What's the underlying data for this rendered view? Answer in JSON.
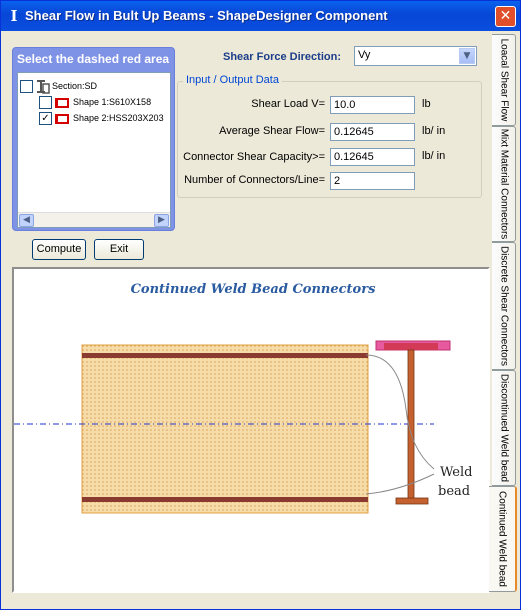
{
  "window": {
    "title": "Shear Flow in Bult Up Beams - ShapeDesigner Component",
    "close_glyph": "✕"
  },
  "selection_panel": {
    "title": "Select the dashed red area",
    "tree": [
      {
        "label": "Section:SD",
        "checked": false
      },
      {
        "label": "Shape 1:S610X158",
        "checked": false
      },
      {
        "label": "Shape 2:HSS203X203",
        "checked": true
      }
    ]
  },
  "buttons": {
    "compute": "Compute",
    "exit": "Exit"
  },
  "shear_direction": {
    "label": "Shear Force Direction:",
    "value": "Vy"
  },
  "io": {
    "legend": "Input / Output Data",
    "fields": [
      {
        "label": "Shear Load V=",
        "value": "10.0",
        "unit": "lb"
      },
      {
        "label": "Average Shear Flow=",
        "value": "0.12645",
        "unit": "lb/ in"
      },
      {
        "label": "Connector Shear Capacity>=",
        "value": "0.12645",
        "unit": "lb/ in"
      },
      {
        "label": "Number of Connectors/Line=",
        "value": "2",
        "unit": ""
      }
    ]
  },
  "display": {
    "title": "Continued Weld Bead Connectors",
    "annotation_line1": "Weld",
    "annotation_line2": "bead",
    "colors": {
      "plate_fill": "#f3d79f",
      "plate_border": "#e0a040",
      "weld_bar": "#8b3a2f",
      "ibeam": "#c4612e",
      "flange_highlight": "#e85aa0",
      "axis": "#2233cc"
    }
  },
  "tabs": [
    {
      "label": "Loacal Shear Flow",
      "selected": false
    },
    {
      "label": "Mixt Material Connectors",
      "selected": false
    },
    {
      "label": "Discrete Shear Connectors",
      "selected": false
    },
    {
      "label": "Discontinued Weld bead",
      "selected": false
    },
    {
      "label": "Continued Weld bead",
      "selected": true
    }
  ]
}
